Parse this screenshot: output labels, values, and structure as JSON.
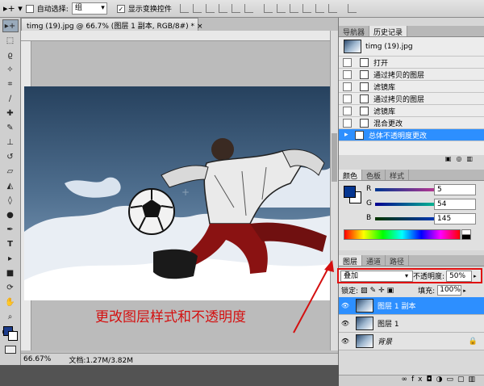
{
  "options": {
    "auto_select_label": "自动选择:",
    "auto_select_value": "组",
    "show_transform_label": "显示变换控件"
  },
  "document": {
    "tab_title": "timg (19).jpg @ 66.7% (图层 1 副本, RGB/8#) *",
    "zoom": "66.67%",
    "doc_size": "文档:1.27M/3.82M"
  },
  "annotation": "更改图层样式和不透明度",
  "history_panel": {
    "tabs": [
      "导航器",
      "历史记录"
    ],
    "snapshot": "timg (19).jpg",
    "items": [
      "打开",
      "通过拷贝的图层",
      "滤镜库",
      "通过拷贝的图层",
      "滤镜库",
      "混合更改",
      "总体不透明度更改"
    ]
  },
  "color_panel": {
    "tabs": [
      "颜色",
      "色板",
      "样式"
    ],
    "channels": [
      {
        "label": "R",
        "value": "5"
      },
      {
        "label": "G",
        "value": "54"
      },
      {
        "label": "B",
        "value": "145"
      }
    ],
    "fg_color": "#053691"
  },
  "layers_panel": {
    "tabs": [
      "图层",
      "通道",
      "路径"
    ],
    "blend_mode": "叠加",
    "opacity_label": "不透明度:",
    "opacity_value": "50%",
    "lock_label": "锁定:",
    "fill_label": "填充:",
    "fill_value": "100%",
    "layers": [
      {
        "name": "图层 1 副本"
      },
      {
        "name": "图层 1"
      },
      {
        "name": "背景"
      }
    ]
  }
}
